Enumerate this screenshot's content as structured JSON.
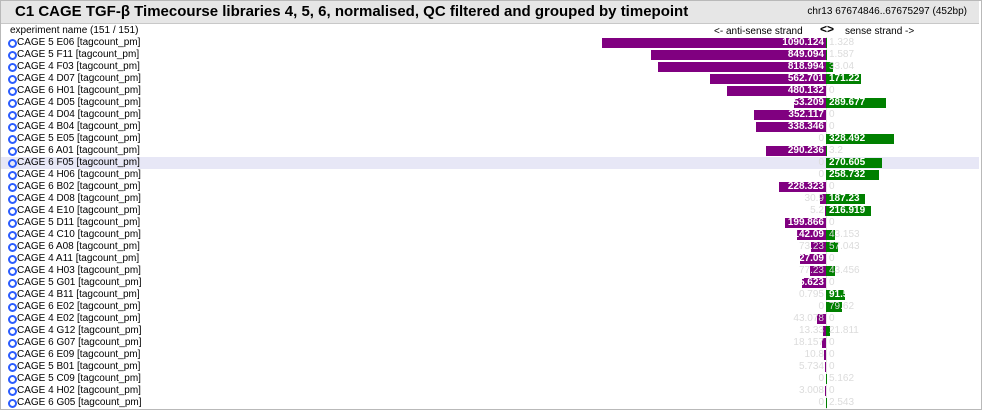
{
  "panel": {
    "title": "C1 CAGE TGF-β Timecourse libraries 4, 5, 6, normalised, QC filtered and grouped by timepoint",
    "region": "chr13 67674846..67675297 (452bp)",
    "column_header": "experiment name (151 / 151)",
    "antisense_label": "<- anti-sense strand",
    "strand_toggle": "<>",
    "sense_label": "sense strand ->"
  },
  "colors": {
    "antisense": "#800080",
    "sense": "#008000",
    "row_icon": "#2b5cff",
    "highlight_row": "#e7e7f6"
  },
  "highlighted_row": "CAGE 6 F05 [tagcount_pm]",
  "chart_data": {
    "type": "bar",
    "orientation": "horizontal-diverging",
    "categories": [
      "CAGE 5 E06 [tagcount_pm]",
      "CAGE 5 F11 [tagcount_pm]",
      "CAGE 4 F03 [tagcount_pm]",
      "CAGE 4 D07 [tagcount_pm]",
      "CAGE 6 H01 [tagcount_pm]",
      "CAGE 4 D05 [tagcount_pm]",
      "CAGE 4 D04 [tagcount_pm]",
      "CAGE 4 B04 [tagcount_pm]",
      "CAGE 5 E05 [tagcount_pm]",
      "CAGE 6 A01 [tagcount_pm]",
      "CAGE 6 F05 [tagcount_pm]",
      "CAGE 4 H06 [tagcount_pm]",
      "CAGE 6 B02 [tagcount_pm]",
      "CAGE 4 D08 [tagcount_pm]",
      "CAGE 4 E10 [tagcount_pm]",
      "CAGE 5 D11 [tagcount_pm]",
      "CAGE 4 C10 [tagcount_pm]",
      "CAGE 6 A08 [tagcount_pm]",
      "CAGE 4 A11 [tagcount_pm]",
      "CAGE 4 H03 [tagcount_pm]",
      "CAGE 5 G01 [tagcount_pm]",
      "CAGE 4 B11 [tagcount_pm]",
      "CAGE 6 E02 [tagcount_pm]",
      "CAGE 4 E02 [tagcount_pm]",
      "CAGE 4 G12 [tagcount_pm]",
      "CAGE 6 G07 [tagcount_pm]",
      "CAGE 6 E09 [tagcount_pm]",
      "CAGE 5 B01 [tagcount_pm]",
      "CAGE 5 C09 [tagcount_pm]",
      "CAGE 4 H02 [tagcount_pm]",
      "CAGE 6 G05 [tagcount_pm]"
    ],
    "series": [
      {
        "name": "anti-sense strand",
        "values": [
          1090.124,
          849.094,
          818.994,
          562.701,
          480.132,
          153.209,
          352.117,
          338.346,
          0,
          290.236,
          0,
          0,
          228.323,
          30.9,
          5.2,
          199.866,
          142.09,
          73.23,
          127.09,
          77.23,
          115.623,
          0.795,
          0,
          43.078,
          13.33,
          18.157,
          10.8,
          5.734,
          0,
          3.008,
          0
        ],
        "labels": [
          "1090.124",
          "849.094",
          "818.994",
          "562.701",
          "480.132",
          "153.209",
          "352.117",
          "338.346",
          "0",
          "290.236",
          "0",
          "0",
          "228.323",
          "30.9",
          "5.2",
          "199.866",
          "142.09",
          "73.23",
          "127.09",
          "77.23",
          "115.623",
          "0.795",
          "0",
          "43.078",
          "13.33",
          "18.157",
          "10.8",
          "5.734",
          "0",
          "3.008",
          "0"
        ]
      },
      {
        "name": "sense strand",
        "values": [
          1.328,
          1.587,
          33.04,
          171.22,
          0,
          289.677,
          0,
          0,
          328.492,
          3.2,
          270.605,
          258.732,
          0,
          187.23,
          216.919,
          0,
          43.153,
          57.043,
          0,
          43.456,
          0,
          91.575,
          79.62,
          0,
          21.811,
          0,
          0,
          0,
          5.162,
          0,
          2.543
        ],
        "labels": [
          "1.328",
          "1.587",
          "33.04",
          "171.22",
          "0",
          "289.677",
          "0",
          "0",
          "328.492",
          "3.2",
          "270.605",
          "258.732",
          "0",
          "187.23",
          "216.919",
          "0",
          "43.153",
          "57.043",
          "0",
          "43.456",
          "0",
          "91.575",
          "79.62",
          "0",
          "21.811",
          "0",
          "0",
          "0",
          "5.162",
          "0",
          "2.543"
        ]
      }
    ],
    "xlim": [
      -1100,
      350
    ],
    "grid": false,
    "legend": "top"
  }
}
